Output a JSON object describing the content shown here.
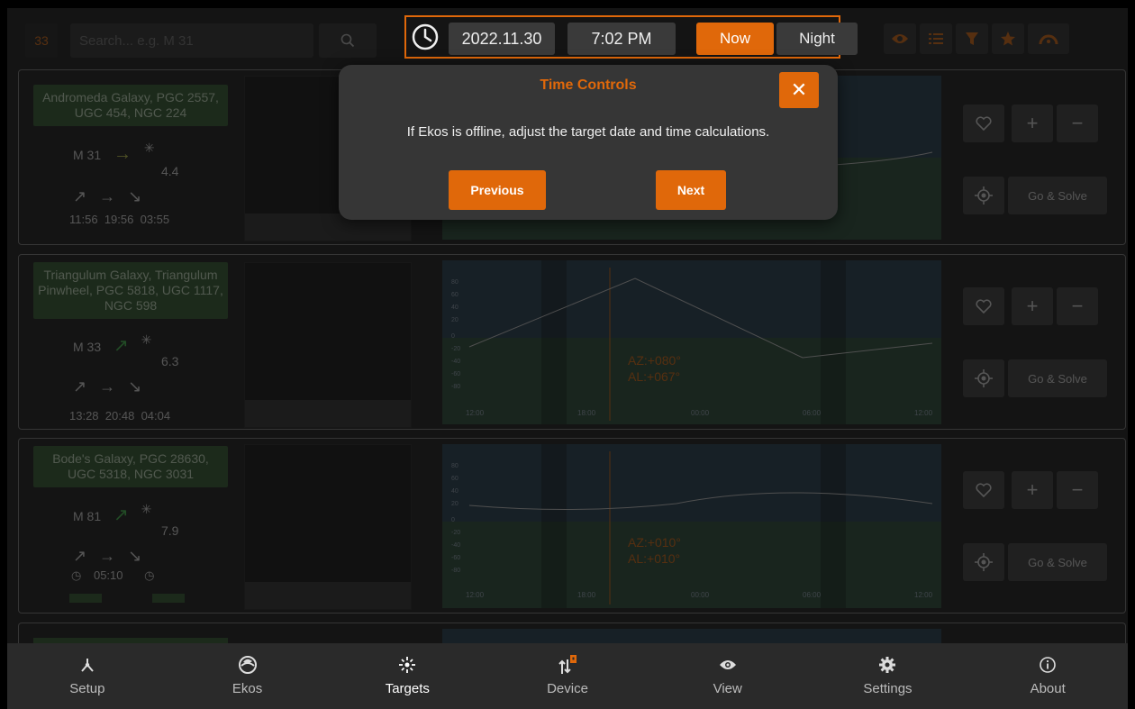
{
  "toolbar": {
    "count": "33",
    "search_placeholder": "Search... e.g. M 31"
  },
  "time_controls": {
    "date": "2022.11.30",
    "time": "7:02 PM",
    "now_label": "Now",
    "night_label": "Night"
  },
  "targets": [
    {
      "name": "Andromeda Galaxy, PGC 2557, UGC 454, NGC 224",
      "id": "M 31",
      "magnitude": "4.4",
      "rise": "11:56",
      "transit": "19:56",
      "set": "03:55",
      "az": "",
      "al": ""
    },
    {
      "name": "Triangulum Galaxy, Triangulum Pinwheel, PGC 5818, UGC 1117, NGC 598",
      "id": "M 33",
      "magnitude": "6.3",
      "rise": "13:28",
      "transit": "20:48",
      "set": "04:04",
      "az": "AZ:+080°",
      "al": "AL:+067°"
    },
    {
      "name": "Bode's Galaxy, PGC 28630, UGC 5318, NGC 3031",
      "id": "M 81",
      "magnitude": "7.9",
      "rise": "",
      "transit": "05:10",
      "set": "",
      "az": "AZ:+010°",
      "al": "AL:+010°"
    }
  ],
  "chart_axes": {
    "x_ticks": [
      "12:00",
      "18:00",
      "00:00",
      "06:00",
      "12:00"
    ],
    "y_ticks": [
      "80",
      "60",
      "40",
      "20",
      "0",
      "-20",
      "-40",
      "-60",
      "-80"
    ]
  },
  "card_actions": {
    "go_solve_label": "Go & Solve"
  },
  "popup": {
    "title": "Time Controls",
    "message": "If Ekos is offline, adjust the target date and time calculations.",
    "previous_label": "Previous",
    "next_label": "Next"
  },
  "bottom_nav": {
    "items": [
      {
        "label": "Setup",
        "icon": "setup-icon"
      },
      {
        "label": "Ekos",
        "icon": "ekos-icon"
      },
      {
        "label": "Targets",
        "icon": "targets-icon"
      },
      {
        "label": "Device",
        "icon": "device-icon"
      },
      {
        "label": "View",
        "icon": "view-icon"
      },
      {
        "label": "Settings",
        "icon": "settings-icon"
      },
      {
        "label": "About",
        "icon": "about-icon"
      }
    ],
    "active": "Targets"
  },
  "colors": {
    "accent": "#e0680a",
    "name_box": "#2e5a2a",
    "chart_sky": "#1e3a4e",
    "chart_ground": "#244a34"
  }
}
